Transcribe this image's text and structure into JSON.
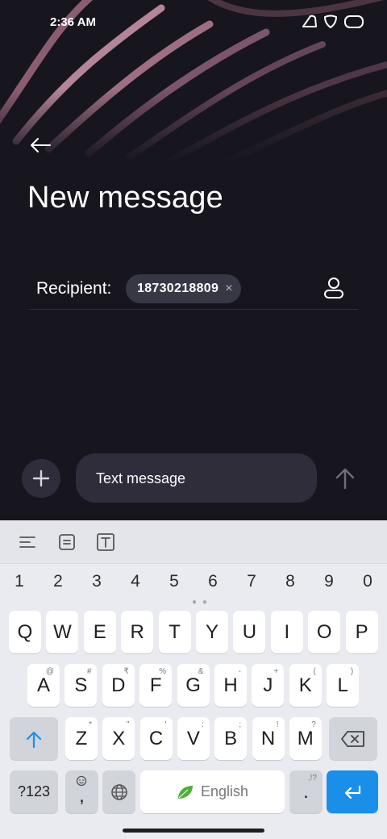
{
  "status": {
    "time": "2:36 AM"
  },
  "header": {
    "title": "New message"
  },
  "recipient": {
    "label": "Recipient:",
    "chip_number": "18730218809",
    "chip_remove": "×"
  },
  "composer": {
    "placeholder": "Text message"
  },
  "keyboard": {
    "numbers": [
      "1",
      "2",
      "3",
      "4",
      "5",
      "6",
      "7",
      "8",
      "9",
      "0"
    ],
    "row1": [
      {
        "k": "Q",
        "s": ""
      },
      {
        "k": "W",
        "s": ""
      },
      {
        "k": "E",
        "s": ""
      },
      {
        "k": "R",
        "s": ""
      },
      {
        "k": "T",
        "s": ""
      },
      {
        "k": "Y",
        "s": ""
      },
      {
        "k": "U",
        "s": ""
      },
      {
        "k": "I",
        "s": ""
      },
      {
        "k": "O",
        "s": ""
      },
      {
        "k": "P",
        "s": ""
      }
    ],
    "row2": [
      {
        "k": "A",
        "s": "@"
      },
      {
        "k": "S",
        "s": "#"
      },
      {
        "k": "D",
        "s": "₹"
      },
      {
        "k": "F",
        "s": "%"
      },
      {
        "k": "G",
        "s": "&"
      },
      {
        "k": "H",
        "s": "-"
      },
      {
        "k": "J",
        "s": "+"
      },
      {
        "k": "K",
        "s": "("
      },
      {
        "k": "L",
        "s": ")"
      }
    ],
    "row3": [
      {
        "k": "Z",
        "s": "*"
      },
      {
        "k": "X",
        "s": "\""
      },
      {
        "k": "C",
        "s": "'"
      },
      {
        "k": "V",
        "s": ":"
      },
      {
        "k": "B",
        "s": ";"
      },
      {
        "k": "N",
        "s": "!"
      },
      {
        "k": "M",
        "s": "?"
      }
    ],
    "symbols_label": "?123",
    "comma_label": ",",
    "space_label": "English",
    "period_label": ".",
    "period_sub": ",!?"
  },
  "colors": {
    "accent": "#1a8fea",
    "app_bg": "#17161f",
    "chip_bg": "#383744",
    "field_bg": "#2e2d39",
    "leaf": "#4caf3a"
  }
}
